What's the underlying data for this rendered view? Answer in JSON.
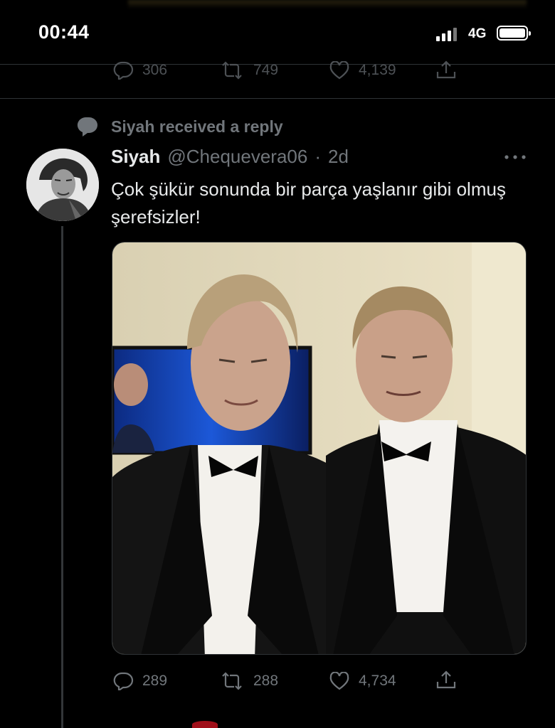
{
  "status_bar": {
    "time": "00:44",
    "network": "4G"
  },
  "previous_tweet": {
    "actions": {
      "replies": "306",
      "retweets": "749",
      "likes": "4,139"
    }
  },
  "tweet": {
    "context": "Siyah received a reply",
    "author_name": "Siyah",
    "handle": "@Chequevera06",
    "separator": "·",
    "time": "2d",
    "text": "Çok şükür sonunda bir parça yaşlanır gibi olmuş şerefsizler!",
    "actions": {
      "replies": "289",
      "retweets": "288",
      "likes": "4,734"
    }
  },
  "colors": {
    "background": "#000000",
    "text": "#e7e9ea",
    "muted": "#71767b",
    "divider": "#2f3336"
  },
  "icons": [
    "reply-icon",
    "retweet-icon",
    "like-icon",
    "share-icon",
    "more-icon",
    "speech-bubble-icon"
  ]
}
